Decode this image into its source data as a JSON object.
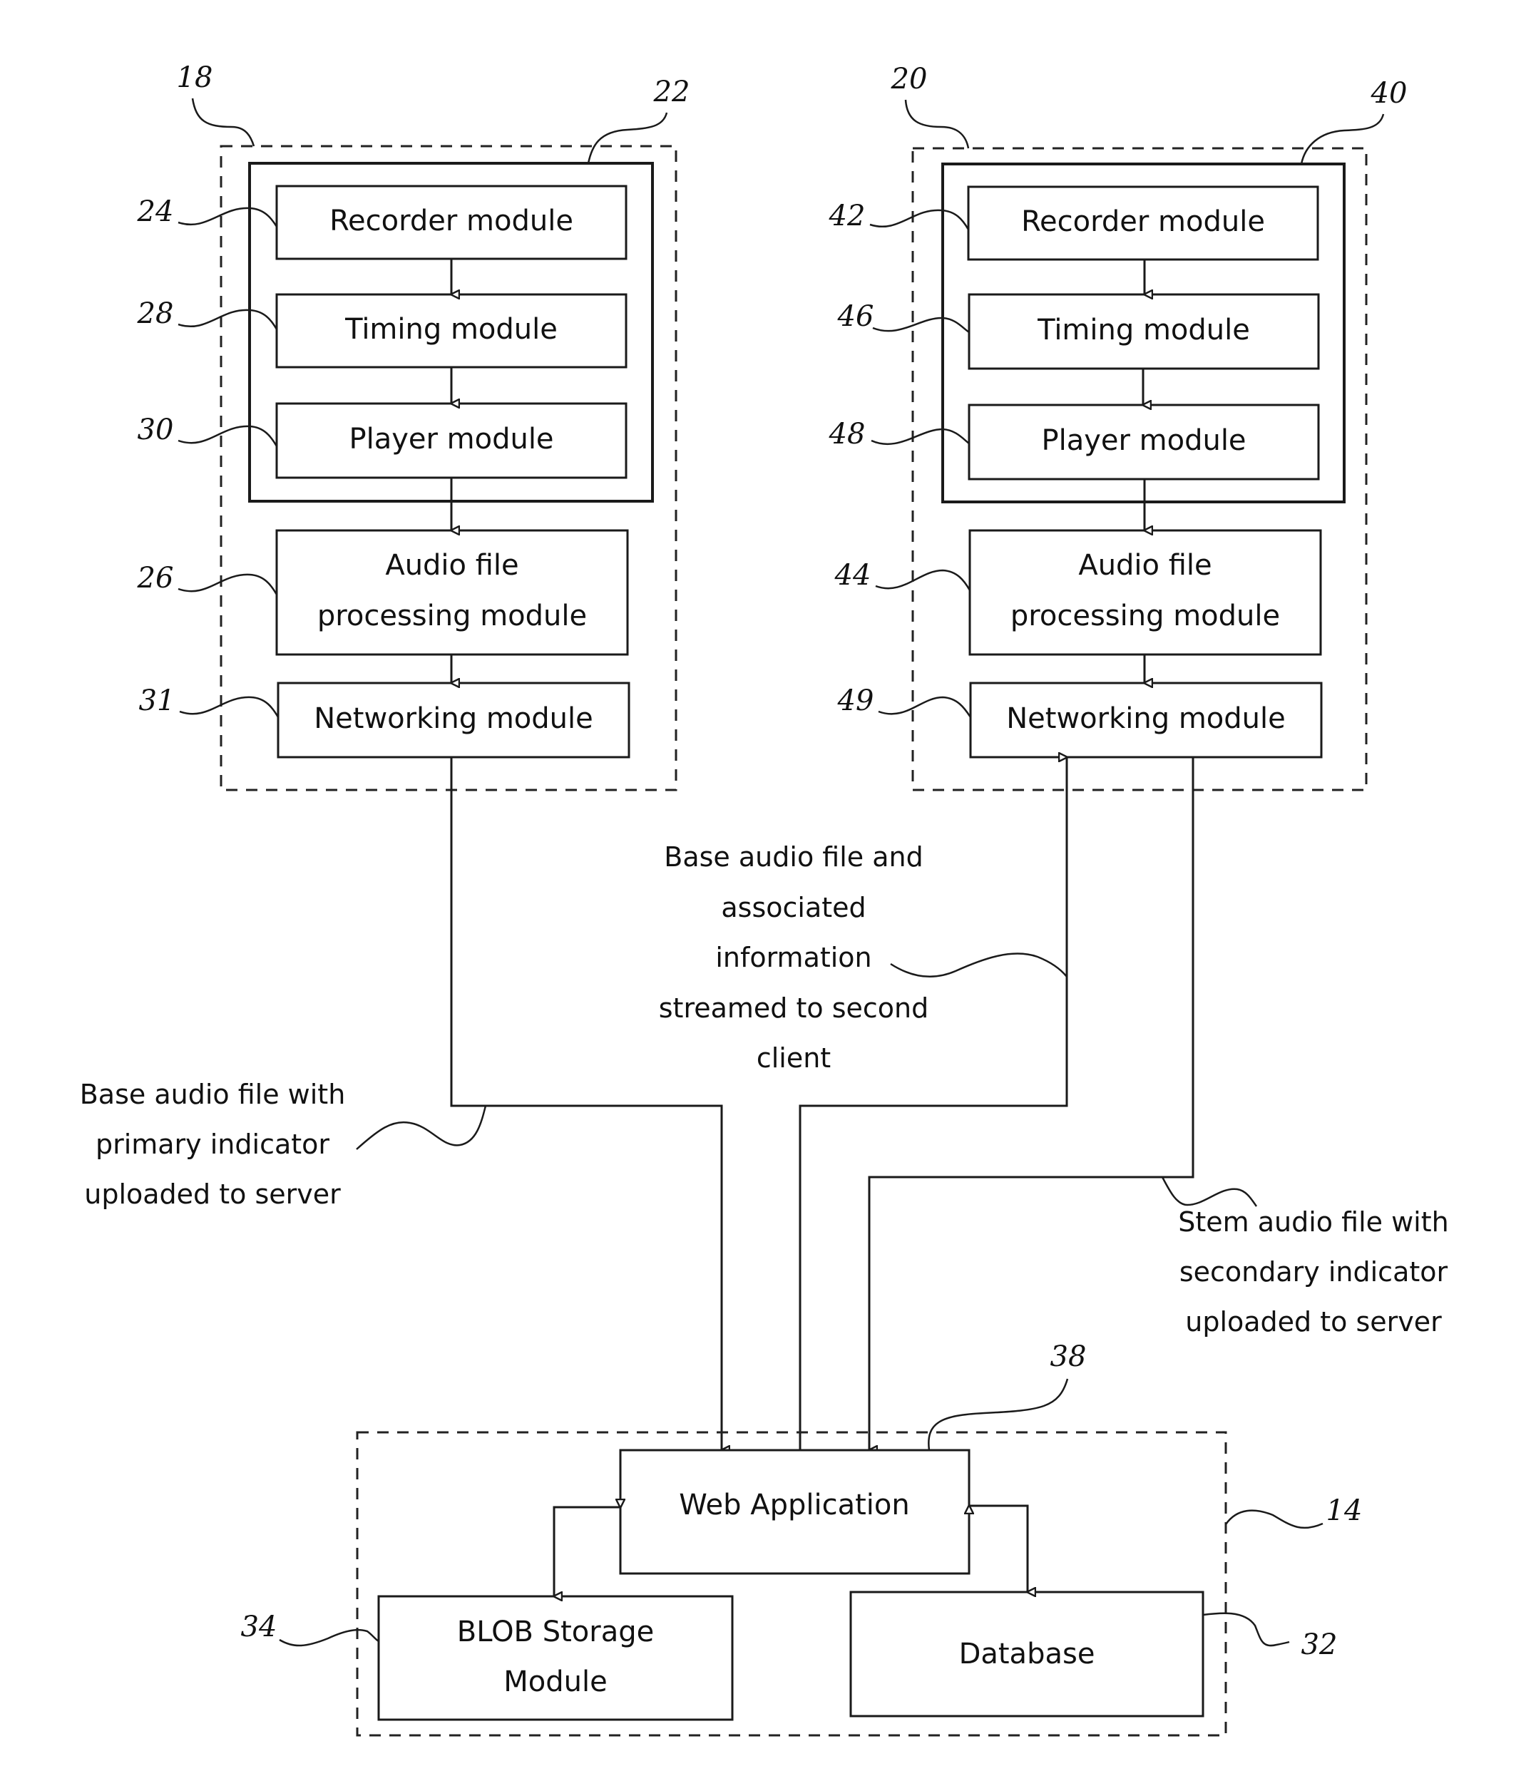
{
  "figure": {
    "client_first": {
      "ref": "18",
      "group_ref": "22",
      "modules": [
        {
          "ref": "24",
          "label": "Recorder module"
        },
        {
          "ref": "28",
          "label": "Timing module"
        },
        {
          "ref": "30",
          "label": "Player module"
        },
        {
          "ref": "26",
          "label_lines": [
            "Audio file",
            "processing module"
          ]
        },
        {
          "ref": "31",
          "label": "Networking module"
        }
      ]
    },
    "client_second": {
      "ref": "20",
      "group_ref": "40",
      "modules": [
        {
          "ref": "42",
          "label": "Recorder module"
        },
        {
          "ref": "46",
          "label": "Timing module"
        },
        {
          "ref": "48",
          "label": "Player module"
        },
        {
          "ref": "44",
          "label_lines": [
            "Audio file",
            "processing module"
          ]
        },
        {
          "ref": "49",
          "label": "Networking module"
        }
      ]
    },
    "server": {
      "ref": "14",
      "web_app": {
        "ref": "38",
        "label": "Web Application"
      },
      "blob": {
        "ref": "34",
        "label_lines": [
          "BLOB Storage",
          "Module"
        ]
      },
      "database": {
        "ref": "32",
        "label": "Database"
      }
    },
    "annotations": {
      "upload_base": [
        "Base audio file with",
        "primary indicator",
        "uploaded to server"
      ],
      "stream_base": [
        "Base audio file and",
        "associated",
        "information",
        "streamed to second",
        "client"
      ],
      "upload_stem": [
        "Stem audio file with",
        "secondary indicator",
        "uploaded to server"
      ]
    }
  }
}
